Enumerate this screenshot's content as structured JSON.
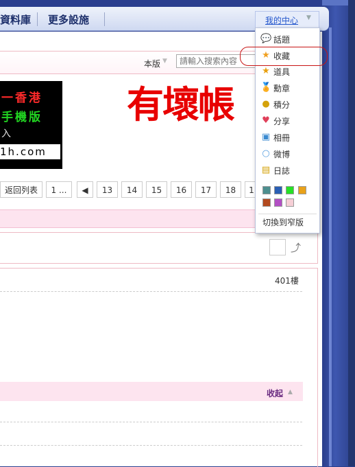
{
  "nav": {
    "items": [
      "資料庫",
      "更多設施"
    ],
    "my_center": "我的中心"
  },
  "search": {
    "scope": "本版",
    "placeholder": "請輸入搜索內容"
  },
  "banner": {
    "logo_line1": "一香港",
    "logo_line2": "手機版",
    "logo_line3": "入",
    "logo_line4": "1h.com",
    "headline": "有壞帳"
  },
  "pager": {
    "back": "返回列表",
    "first": "1 ...",
    "pages": [
      "13",
      "14",
      "15",
      "16",
      "17",
      "18",
      "1"
    ]
  },
  "post": {
    "floor": "401樓",
    "collapse": "收起"
  },
  "menu": {
    "items": [
      {
        "label": "話題",
        "icon": "topic-icon"
      },
      {
        "label": "收藏",
        "icon": "star-icon"
      },
      {
        "label": "道具",
        "icon": "magic-icon"
      },
      {
        "label": "勳章",
        "icon": "medal-icon"
      },
      {
        "label": "積分",
        "icon": "coins-icon"
      },
      {
        "label": "分享",
        "icon": "share-icon"
      },
      {
        "label": "相冊",
        "icon": "album-icon"
      },
      {
        "label": "微博",
        "icon": "weibo-icon"
      },
      {
        "label": "日誌",
        "icon": "journal-icon"
      }
    ],
    "swatches": [
      "#4d8f8f",
      "#2a5fb4",
      "#27e027",
      "#e9a21a",
      "#b24a1f",
      "#b24fc4",
      "#f6cfd6"
    ],
    "switch_narrow": "切換到窄版"
  }
}
